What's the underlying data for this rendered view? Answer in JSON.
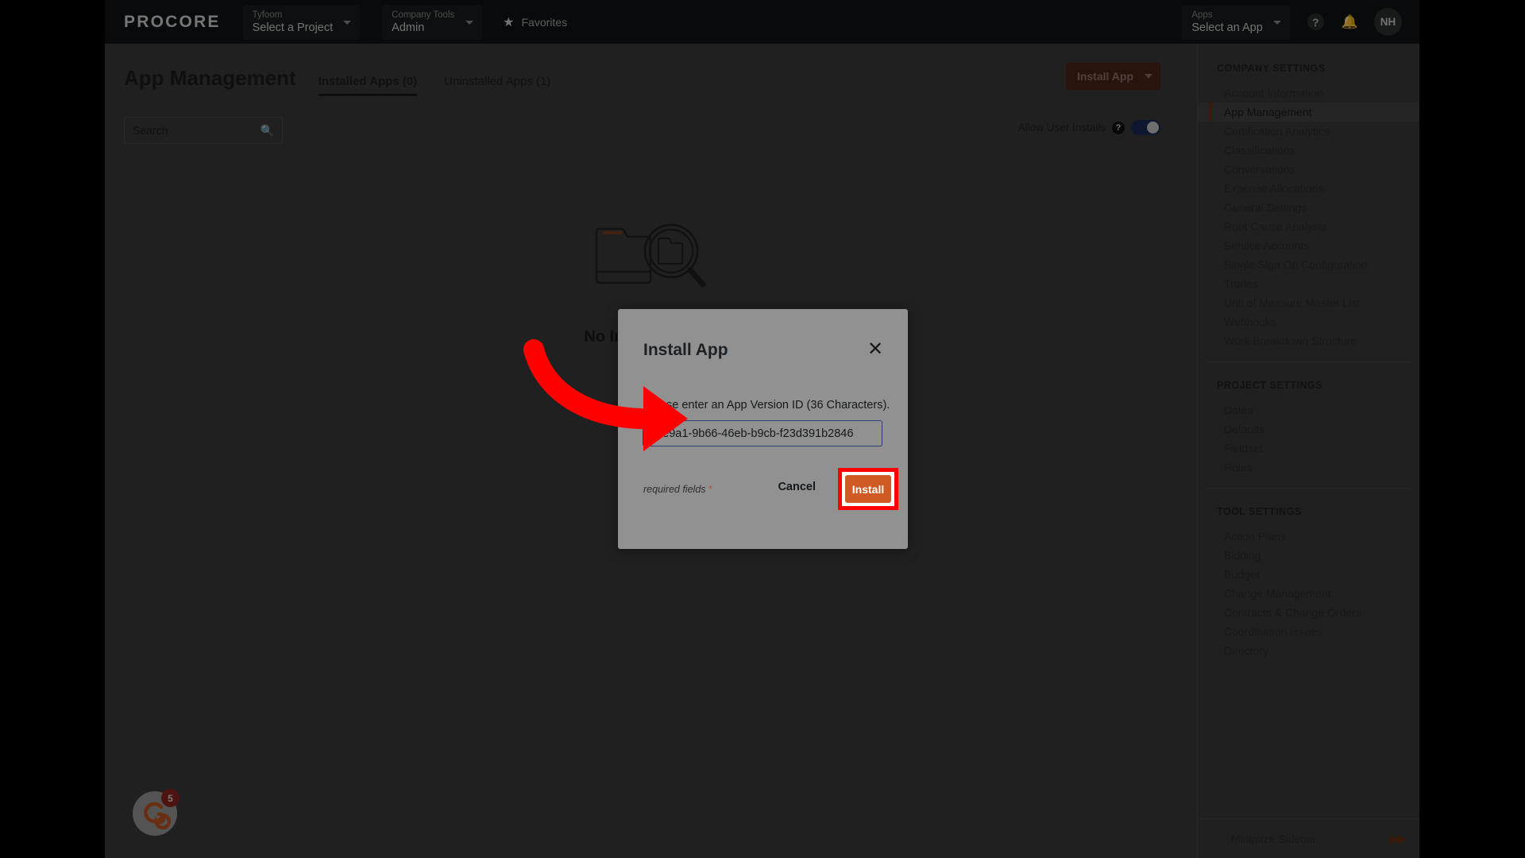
{
  "topnav": {
    "logo": "PROCORE",
    "project_select": {
      "label": "Tyfoom",
      "value": "Select a Project"
    },
    "tools_select": {
      "label": "Company Tools",
      "value": "Admin"
    },
    "favorites": {
      "icon": "star-icon",
      "label": "Favorites"
    },
    "apps_select": {
      "label": "Apps",
      "value": "Select an App"
    },
    "help_icon": "?",
    "notifications_icon": "bell-icon",
    "avatar_initials": "NH"
  },
  "page": {
    "title": "App Management",
    "tabs": [
      {
        "label": "Installed Apps (0)",
        "active": true
      },
      {
        "label": "Uninstalled Apps (1)",
        "active": false
      }
    ],
    "search": {
      "placeholder": "Search",
      "value": "",
      "icon": "search-icon"
    },
    "install_app_button": "Install App",
    "allow_user_installs": {
      "label": "Allow User Installs",
      "help_icon": "?",
      "toggle_on": true
    },
    "empty_state": {
      "illustration": "folder-magnifier-icon",
      "title": "No Installed Apps"
    },
    "chat_widget": {
      "icon": "spiral-icon",
      "badge": "5"
    }
  },
  "right_rail": {
    "sections": [
      {
        "heading": "COMPANY SETTINGS",
        "items": [
          {
            "label": "Account Information",
            "selected": false
          },
          {
            "label": "App Management",
            "selected": true
          },
          {
            "label": "Certification Analytics",
            "selected": false
          },
          {
            "label": "Classifications",
            "selected": false
          },
          {
            "label": "Conversations",
            "selected": false
          },
          {
            "label": "Expense Allocations",
            "selected": false
          },
          {
            "label": "General Settings",
            "selected": false
          },
          {
            "label": "Root Cause Analysis",
            "selected": false
          },
          {
            "label": "Service Accounts",
            "selected": false
          },
          {
            "label": "Single Sign On Configuration",
            "selected": false
          },
          {
            "label": "Trades",
            "selected": false
          },
          {
            "label": "Unit of Measure Master List",
            "selected": false
          },
          {
            "label": "Webhooks",
            "selected": false
          },
          {
            "label": "Work Breakdown Structure",
            "selected": false
          }
        ]
      },
      {
        "heading": "PROJECT SETTINGS",
        "items": [
          {
            "label": "Dates",
            "selected": false
          },
          {
            "label": "Defaults",
            "selected": false
          },
          {
            "label": "Fieldset",
            "selected": false
          },
          {
            "label": "Roles",
            "selected": false
          }
        ]
      },
      {
        "heading": "TOOL SETTINGS",
        "items": [
          {
            "label": "Action Plans",
            "selected": false
          },
          {
            "label": "Bidding",
            "selected": false
          },
          {
            "label": "Budget",
            "selected": false
          },
          {
            "label": "Change Management",
            "selected": false
          },
          {
            "label": "Contracts & Change Orders",
            "selected": false
          },
          {
            "label": "Coordination Issues",
            "selected": false
          },
          {
            "label": "Directory",
            "selected": false
          }
        ]
      }
    ],
    "minimize": {
      "label": "Minimize Sidebar",
      "icon": "double-chevron-right-icon"
    }
  },
  "modal": {
    "title": "Install App",
    "close_icon": "close-icon",
    "instruction": "Please enter an App Version ID (36 Characters).",
    "input": {
      "value": "12e9a1-9b66-46eb-b9cb-f23d391b2846",
      "placeholder": ""
    },
    "required_fields_note": "required fields",
    "required_asterisk": "*",
    "cancel_label": "Cancel",
    "install_label": "Install"
  },
  "annotation": {
    "type": "curved-arrow",
    "color": "#ff0000",
    "points_to": "install-button",
    "highlight_box_color": "#ff0000"
  },
  "colors": {
    "accent_orange": "#cf5a23",
    "topnav_bg": "#111314",
    "page_bg": "#3b3b3b",
    "modal_bg": "#919191",
    "annotation_red": "#ff0000",
    "toggle_on": "#1c2b56"
  }
}
